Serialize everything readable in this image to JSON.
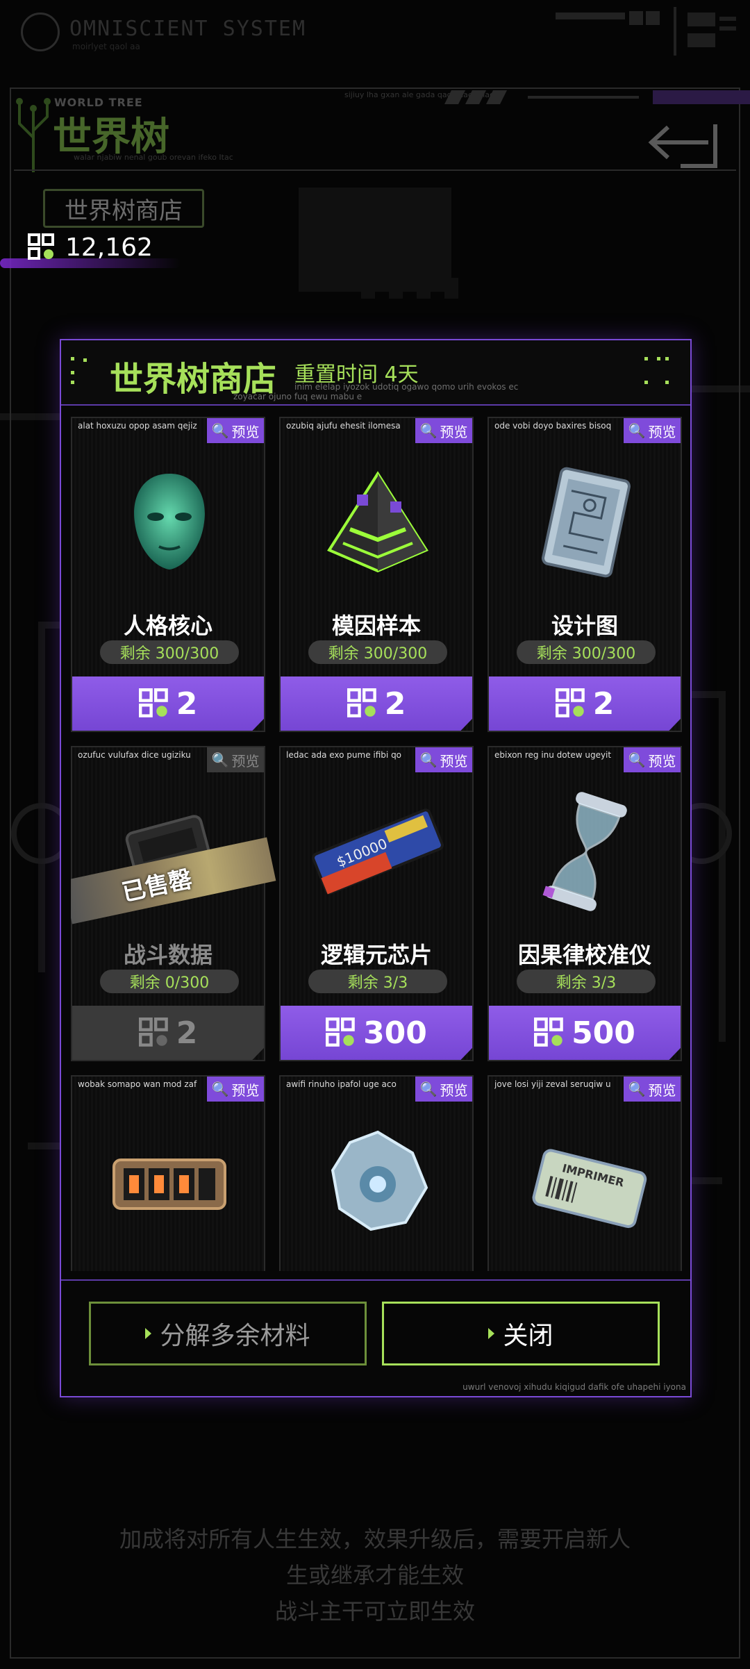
{
  "system": {
    "title": "OMNISCIENT SYSTEM",
    "subtitle": "moirlyet qaol aa"
  },
  "header": {
    "title_en": "WORLD TREE",
    "title_cn": "世界树",
    "sub_text": "walar njabiw nenal goub orevan ifeko Itac",
    "top_text": "sijiuy lha gxan ale gada qaqn liaeta iao"
  },
  "shop_tag": "世界树商店",
  "currency": {
    "icon": "qr-token-icon",
    "amount": "12,162"
  },
  "dialog": {
    "title": "世界树商店",
    "reset_label": "重置时间 4天",
    "meta1": "inim elelap iyozok udotiq ogawo qomo urih evokos ec",
    "meta2": "zoyacar ojuno fuq ewu mabu e",
    "preview_label": "预览",
    "items": [
      {
        "code": "alat hoxuzu opop asam qejiz",
        "name": "人格核心",
        "remaining": "剩余 300/300",
        "price": "2",
        "sold": false,
        "icon": "holographic-head-icon"
      },
      {
        "code": "ozubiq ajufu ehesit ilomesa",
        "name": "模因样本",
        "remaining": "剩余 300/300",
        "price": "2",
        "sold": false,
        "icon": "pyramid-icon"
      },
      {
        "code": "ode vobi doyo baxires bisoq",
        "name": "设计图",
        "remaining": "剩余 300/300",
        "price": "2",
        "sold": false,
        "icon": "circuit-board-icon"
      },
      {
        "code": "ozufuc vulufax dice ugiziku",
        "name": "战斗数据",
        "remaining": "剩余 0/300",
        "price": "2",
        "sold": true,
        "sold_label": "已售罄",
        "icon": "data-module-icon"
      },
      {
        "code": "ledac ada exo pume ifibi qo",
        "name": "逻辑元芯片",
        "remaining": "剩余 3/3",
        "price": "300",
        "sold": false,
        "icon": "chip-icon",
        "chip_text": "$10000"
      },
      {
        "code": "ebixon reg inu dotew ugeyit",
        "name": "因果律校准仪",
        "remaining": "剩余 3/3",
        "price": "500",
        "sold": false,
        "icon": "hourglass-icon"
      },
      {
        "code": "wobak somapo wan mod zaf",
        "name": "",
        "remaining": "",
        "price": "",
        "sold": false,
        "icon": "nixie-display-icon"
      },
      {
        "code": "awifi rinuho ipafol uge aco",
        "name": "",
        "remaining": "",
        "price": "",
        "sold": false,
        "icon": "crystal-icon"
      },
      {
        "code": "jove losi yiji zeval seruqiw u",
        "name": "",
        "remaining": "",
        "price": "",
        "sold": false,
        "icon": "ticket-icon",
        "ticket_text": "IMPRIMER"
      }
    ],
    "buttons": {
      "decompose": "分解多余材料",
      "close": "关闭"
    },
    "footer_meta": "uwurl venovoj xihudu kiqigud dafik ofe uhapehi iyona"
  },
  "bottom_note": [
    "加成将对所有人生生效，效果升级后，需要开启新人",
    "生或继承才能生效",
    "战斗主干可立即生效"
  ],
  "colors": {
    "accent_green": "#a6e05a",
    "accent_purple": "#7f4bdb",
    "background": "#050505"
  }
}
